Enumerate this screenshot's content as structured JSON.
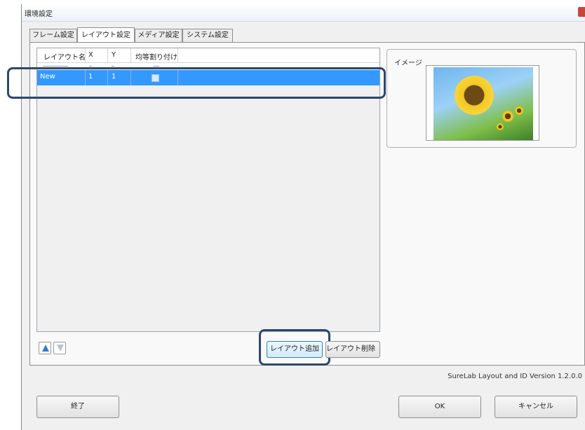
{
  "window": {
    "title": "環境設定"
  },
  "tabs": [
    {
      "label": "フレーム設定"
    },
    {
      "label": "レイアウト設定"
    },
    {
      "label": "メディア設定"
    },
    {
      "label": "システム設定"
    }
  ],
  "layout_table": {
    "columns": [
      "レイアウト名",
      "X",
      "Y",
      "均等割り付け"
    ],
    "selected_row": {
      "name": "New",
      "x": "1",
      "y": "1",
      "even_distribution": false
    }
  },
  "buttons": {
    "add_layout": "レイアウト追加",
    "delete_layout": "レイアウト削除",
    "exit": "終了",
    "ok": "OK",
    "cancel": "キャンセル"
  },
  "image_panel": {
    "label": "イメージ",
    "preview": "sunflower"
  },
  "version_text": "SureLab Layout and ID Version 1.2.0.0",
  "colors": {
    "selection": "#3399ff",
    "highlight_outline": "#2c4770"
  }
}
